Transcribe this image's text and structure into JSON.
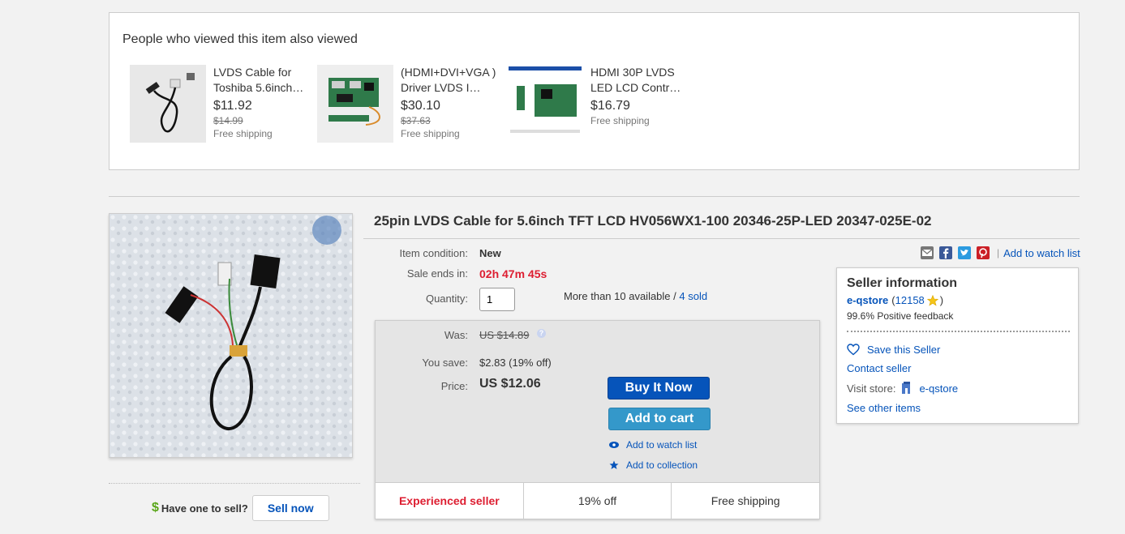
{
  "also_viewed": {
    "title": "People who viewed this item also viewed",
    "items": [
      {
        "name": "LVDS Cable for Toshiba 5.6inch…",
        "price": "$11.92",
        "was": "$14.99",
        "shipping": "Free shipping"
      },
      {
        "name": "(HDMI+DVI+VGA ) Driver LVDS I…",
        "price": "$30.10",
        "was": "$37.63",
        "shipping": "Free shipping"
      },
      {
        "name": "HDMI 30P LVDS LED LCD Contr…",
        "price": "$16.79",
        "was": "",
        "shipping": "Free shipping"
      }
    ]
  },
  "item": {
    "title": "25pin LVDS Cable for 5.6inch TFT LCD HV056WX1-100 20346-25P-LED 20347-025E-02",
    "condition_label": "Item condition:",
    "condition": "New",
    "sale_label": "Sale ends in:",
    "sale_ends": "02h 47m 45s",
    "quantity_label": "Quantity:",
    "quantity": "1",
    "availability": "More than 10 available /",
    "sold": "4 sold"
  },
  "pricing": {
    "was_label": "Was:",
    "was": "US $14.89",
    "save_label": "You save:",
    "save": "$2.83 (19% off)",
    "price_label": "Price:",
    "price": "US $12.06",
    "buy_now": "Buy It Now",
    "add_to_cart": "Add to cart",
    "add_watch": "Add to watch list",
    "add_collection": "Add to collection",
    "footer": [
      "Experienced seller",
      "19% off",
      "Free shipping"
    ]
  },
  "share": {
    "separator": "|",
    "watch_list": "Add to watch list"
  },
  "seller": {
    "title": "Seller information",
    "name": "e-qstore",
    "score": "12158",
    "feedback": "99.6% Positive feedback",
    "save_seller": "Save this Seller",
    "contact": "Contact seller",
    "visit_label": "Visit store:",
    "store": "e-qstore",
    "other_items": "See other items"
  },
  "sell": {
    "question": "Have one to sell?",
    "button": "Sell now"
  },
  "colors": {
    "link": "#0654ba",
    "buy_now": "#0654ba",
    "add_to_cart": "#3498ca",
    "alert_red": "#dd1e31",
    "dollar_green": "#5ba71b"
  }
}
